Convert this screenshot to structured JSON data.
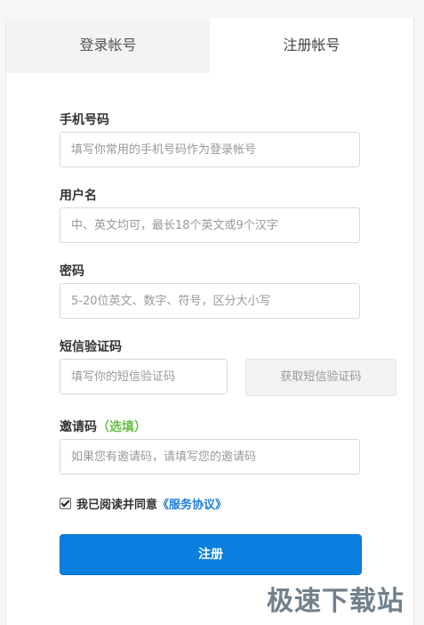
{
  "tabs": {
    "login": "登录帐号",
    "register": "注册帐号"
  },
  "form": {
    "phone": {
      "label": "手机号码",
      "placeholder": "填写你常用的手机号码作为登录帐号"
    },
    "username": {
      "label": "用户名",
      "placeholder": "中、英文均可，最长18个英文或9个汉字"
    },
    "password": {
      "label": "密码",
      "placeholder": "5-20位英文、数字、符号，区分大小写"
    },
    "sms": {
      "label": "短信验证码",
      "placeholder": "填写你的短信验证码",
      "button": "获取短信验证码"
    },
    "invite": {
      "label": "邀请码",
      "optional": "（选填）",
      "placeholder": "如果您有邀请码，请填写您的邀请码"
    },
    "agreement": {
      "checked": true,
      "text": "我已阅读并同意",
      "link": "《服务协议》"
    },
    "submit": "注册"
  },
  "watermark": "极速下载站",
  "colors": {
    "primary": "#0a7fe0",
    "optional": "#6ac04a",
    "link": "#1a7ed6"
  }
}
